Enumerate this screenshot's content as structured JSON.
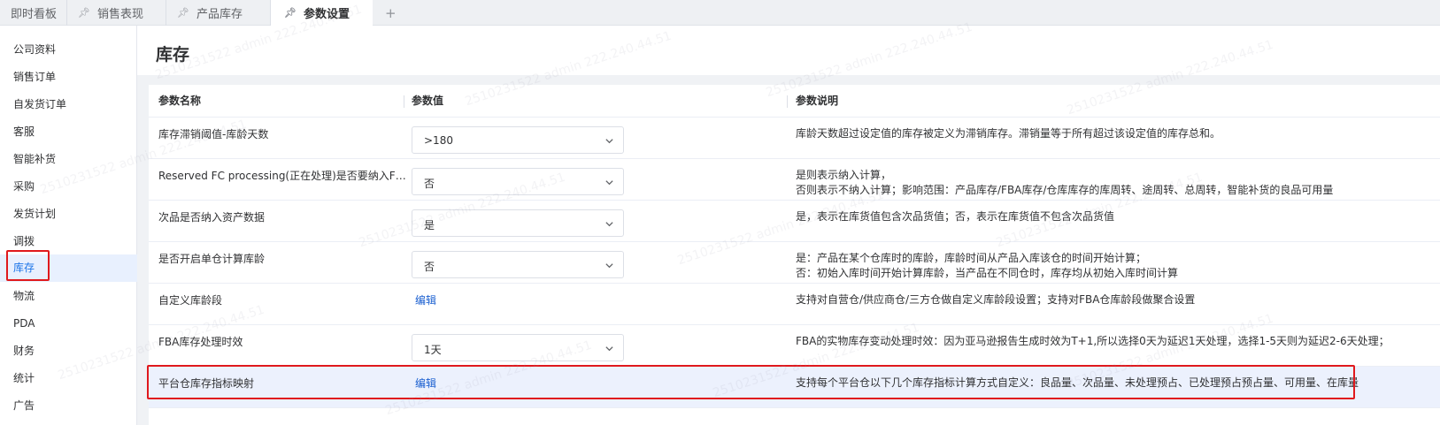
{
  "tabs": [
    {
      "label": "即时看板",
      "pinned": false
    },
    {
      "label": "销售表现",
      "pinned": true
    },
    {
      "label": "产品库存",
      "pinned": true
    },
    {
      "label": "参数设置",
      "pinned": true,
      "active": true
    }
  ],
  "tab_add_icon": "+",
  "sidebar": {
    "items": [
      {
        "label": "公司资料"
      },
      {
        "label": "销售订单"
      },
      {
        "label": "自发货订单"
      },
      {
        "label": "客服"
      },
      {
        "label": "智能补货"
      },
      {
        "label": "采购"
      },
      {
        "label": "发货计划"
      },
      {
        "label": "调拨"
      },
      {
        "label": "库存",
        "active": true
      },
      {
        "label": "物流"
      },
      {
        "label": "PDA"
      },
      {
        "label": "财务"
      },
      {
        "label": "统计"
      },
      {
        "label": "广告"
      }
    ]
  },
  "page": {
    "title": "库存"
  },
  "table": {
    "headers": {
      "name": "参数名称",
      "value": "参数值",
      "desc": "参数说明"
    },
    "rows": [
      {
        "name": "库存滞销阈值-库龄天数",
        "type": "select",
        "value": ">180",
        "desc": [
          "库龄天数超过设定值的库存被定义为滞销库存。滞销量等于所有超过该设定值的库存总和。"
        ]
      },
      {
        "name": "Reserved FC processing(正在处理)是否要纳入FBA...",
        "type": "select",
        "value": "否",
        "desc": [
          "是则表示纳入计算，",
          "否则表示不纳入计算；影响范围：产品库存/FBA库存/仓库库存的库周转、途周转、总周转，智能补货的良品可用量"
        ]
      },
      {
        "name": "次品是否纳入资产数据",
        "type": "select",
        "value": "是",
        "desc": [
          "是，表示在库货值包含次品货值；否，表示在库货值不包含次品货值"
        ]
      },
      {
        "name": "是否开启单仓计算库龄",
        "type": "select",
        "value": "否",
        "desc": [
          "是：产品在某个仓库时的库龄，库龄时间从产品入库该仓的时间开始计算；",
          "否：初始入库时间开始计算库龄，当产品在不同仓时，库存均从初始入库时间计算"
        ]
      },
      {
        "name": "自定义库龄段",
        "type": "link",
        "value": "编辑",
        "desc": [
          "支持对自营仓/供应商仓/三方仓做自定义库龄段设置；支持对FBA仓库龄段做聚合设置"
        ]
      },
      {
        "name": "FBA库存处理时效",
        "type": "select",
        "value": "1天",
        "desc": [
          "FBA的实物库存变动处理时效：因为亚马逊报告生成时效为T+1,所以选择0天为延迟1天处理，选择1-5天则为延迟2-6天处理；"
        ]
      },
      {
        "name": "平台仓库存指标映射",
        "type": "link",
        "value": "编辑",
        "desc": [
          "支持每个平台仓以下几个库存指标计算方式自定义：良品量、次品量、未处理预占、已处理预占预占量、可用量、在库量"
        ],
        "selected": true
      }
    ]
  },
  "watermark_text": "2510231522 admin 222.240.44.51",
  "colors": {
    "accent": "#1a73e8",
    "highlight_border": "#e0191d",
    "link": "#1a5fd0",
    "selected_row": "#ecf1fd"
  }
}
